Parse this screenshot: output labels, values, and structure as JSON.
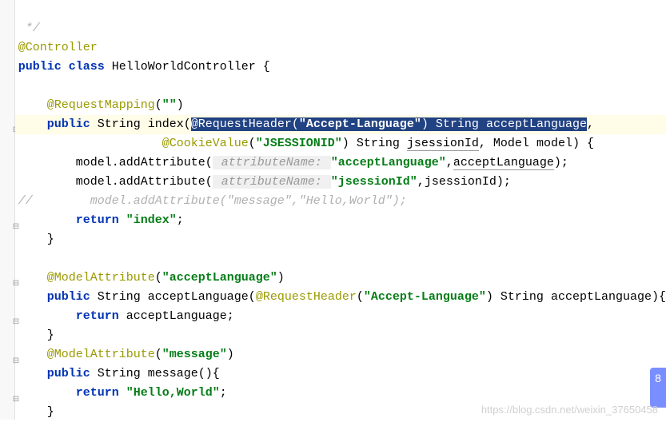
{
  "code": {
    "line1": " */",
    "line2_anno": "@Controller",
    "line3_kw1": "public",
    "line3_kw2": "class",
    "line3_name": "HelloWorldController",
    "line3_brace": " {",
    "line5_anno": "@RequestMapping",
    "line5_paren": "(",
    "line5_str": "\"\"",
    "line5_close": ")",
    "line6_kw": "public",
    "line6_type": "String",
    "line6_method": "index",
    "line6_open": "(",
    "line6_sel_anno": "@RequestHeader",
    "line6_sel_paren": "(",
    "line6_sel_str": "\"Accept-Language\"",
    "line6_sel_close": ")",
    "line6_sel_type": "String",
    "line6_sel_var": "acceptLanguage",
    "line6_comma": ",",
    "line7_anno": "@CookieValue",
    "line7_open": "(",
    "line7_str": "\"JSESSIONID\"",
    "line7_close": ")",
    "line7_type": "String",
    "line7_var": "jsessionId",
    "line7_comma": ",",
    "line7_type2": "Model",
    "line7_var2": "model",
    "line7_end": ") {",
    "line8_pre": "model.addAttribute(",
    "line8_hint": " attributeName: ",
    "line8_str": "\"acceptLanguage\"",
    "line8_comma": ",",
    "line8_var": "acceptLanguage",
    "line8_end": ");",
    "line9_pre": "model.addAttribute(",
    "line9_hint": " attributeName: ",
    "line9_str": "\"jsessionId\"",
    "line9_comma": ",",
    "line9_var": "jsessionId",
    "line9_end": ");",
    "line10_comment_mark": "//",
    "line10_comment": "model.addAttribute(\"message\",\"Hello,World\");",
    "line11_kw": "return",
    "line11_str": "\"index\"",
    "line11_end": ";",
    "line12_brace": "}",
    "line14_anno": "@ModelAttribute",
    "line14_open": "(",
    "line14_str": "\"acceptLanguage\"",
    "line14_close": ")",
    "line15_kw": "public",
    "line15_type": "String",
    "line15_method": "acceptLanguage",
    "line15_open": "(",
    "line15_anno": "@RequestHeader",
    "line15_paren": "(",
    "line15_str": "\"Accept-Language\"",
    "line15_pclose": ")",
    "line15_ptype": "String",
    "line15_pvar": "acceptLanguage",
    "line15_end": "){",
    "line16_kw": "return",
    "line16_var": "acceptLanguage",
    "line16_end": ";",
    "line17_brace": "}",
    "line18_anno": "@ModelAttribute",
    "line18_open": "(",
    "line18_str": "\"message\"",
    "line18_close": ")",
    "line19_kw": "public",
    "line19_type": "String",
    "line19_method": "message",
    "line19_end": "(){",
    "line20_kw": "return",
    "line20_str": "\"Hello,World\"",
    "line20_end": ";",
    "line21_brace": "}"
  },
  "watermark": "https://blog.csdn.net/weixin_37650458",
  "badge": "8"
}
